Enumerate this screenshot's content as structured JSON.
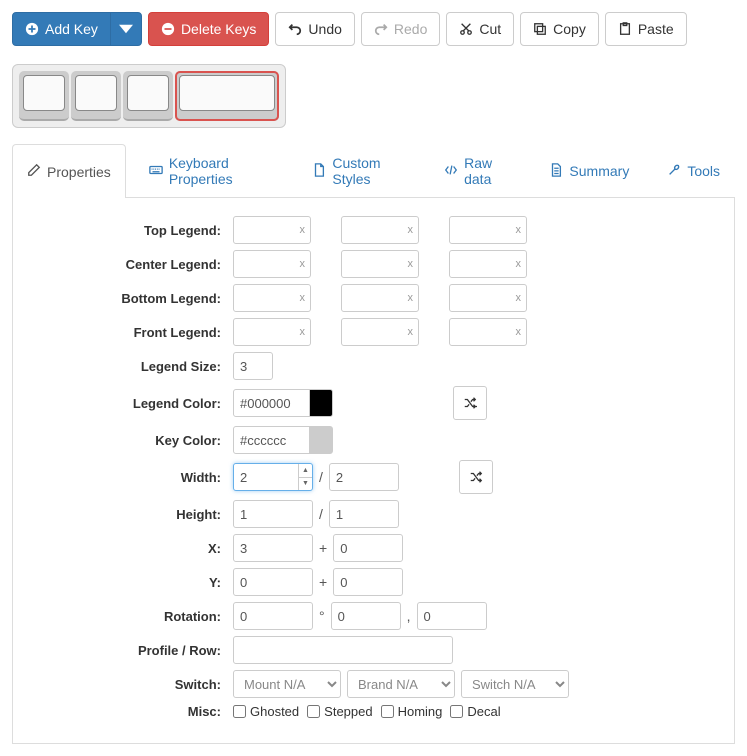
{
  "toolbar": {
    "add_key": "Add Key",
    "delete_keys": "Delete Keys",
    "undo": "Undo",
    "redo": "Redo",
    "cut": "Cut",
    "copy": "Copy",
    "paste": "Paste"
  },
  "tabs": {
    "properties": "Properties",
    "keyboard_properties": "Keyboard Properties",
    "custom_styles": "Custom Styles",
    "raw_data": "Raw data",
    "summary": "Summary",
    "tools": "Tools"
  },
  "labels": {
    "top_legend": "Top Legend:",
    "center_legend": "Center Legend:",
    "bottom_legend": "Bottom Legend:",
    "front_legend": "Front Legend:",
    "legend_size": "Legend Size:",
    "legend_color": "Legend Color:",
    "key_color": "Key Color:",
    "width": "Width:",
    "height": "Height:",
    "x": "X:",
    "y": "Y:",
    "rotation": "Rotation:",
    "profile_row": "Profile / Row:",
    "switch": "Switch:",
    "misc": "Misc:"
  },
  "values": {
    "legend_size": "3",
    "legend_color": "#000000",
    "legend_color_swatch": "#000000",
    "key_color": "#cccccc",
    "key_color_swatch": "#cccccc",
    "width1": "2",
    "width2": "2",
    "height1": "1",
    "height2": "1",
    "x1": "3",
    "x2": "0",
    "y1": "0",
    "y2": "0",
    "rot_angle": "0",
    "rot_x": "0",
    "rot_y": "0",
    "profile_row": "",
    "switch_mount": "Mount N/A",
    "switch_brand": "Brand N/A",
    "switch_type": "Switch N/A"
  },
  "misc": {
    "ghosted": "Ghosted",
    "stepped": "Stepped",
    "homing": "Homing",
    "decal": "Decal"
  },
  "sym": {
    "slash": "/",
    "plus": "+",
    "deg": "°",
    "comma": ",",
    "x": "x"
  }
}
